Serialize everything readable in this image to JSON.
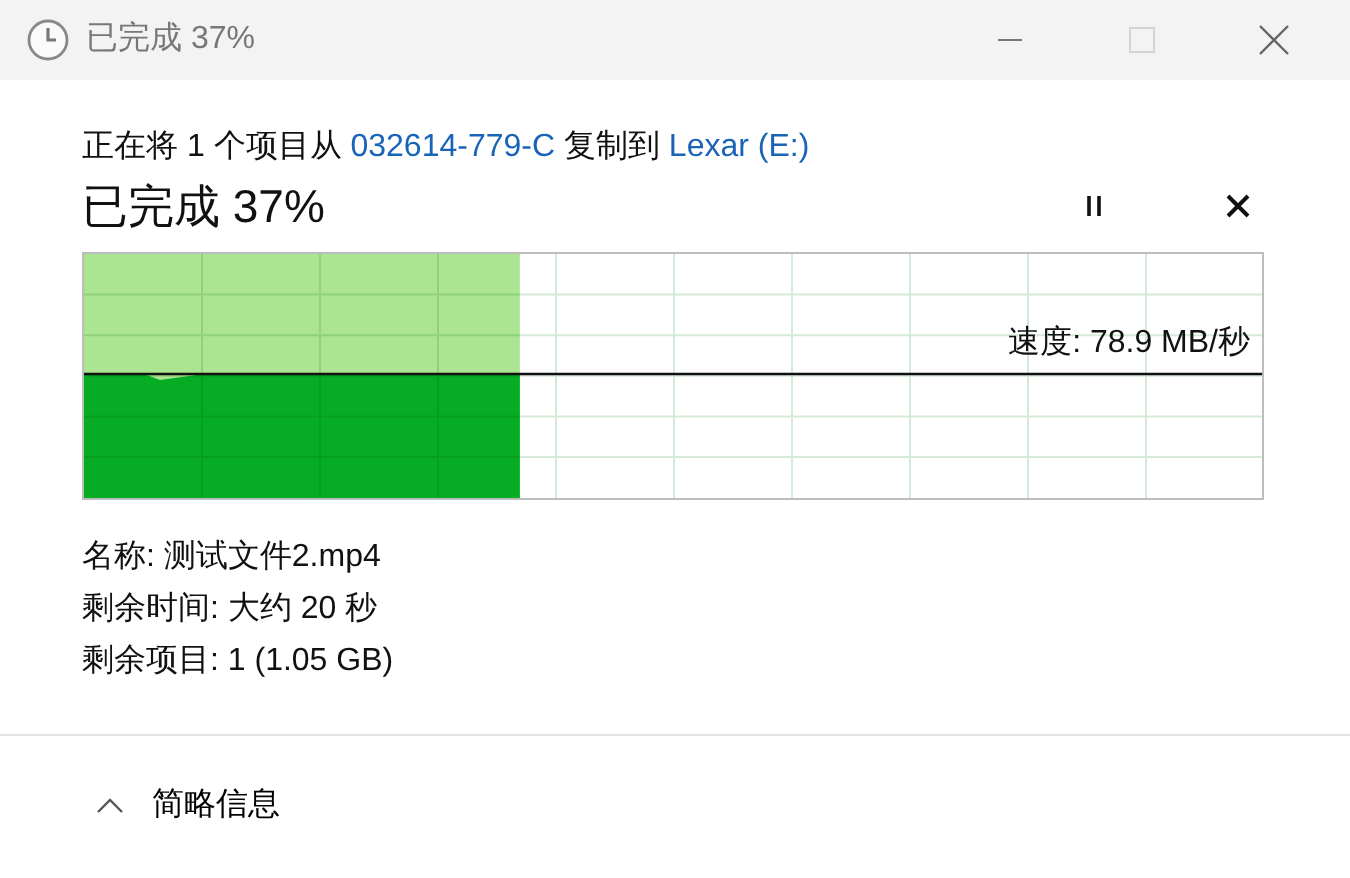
{
  "window": {
    "title": "已完成 37%",
    "maximize_disabled": true
  },
  "header": {
    "before": "正在将 1 个项目从",
    "source": "032614-779-C",
    "middle": "复制到",
    "destination": "Lexar (E:)"
  },
  "progress": {
    "label": "已完成 37%",
    "level": 0.37
  },
  "graph": {
    "speed": "速度: 78.9 MB/秒"
  },
  "details": [
    "名称: 测试文件2.mp4",
    "剩余时间: 大约 20 秒",
    "剩余项目: 1 (1.05 GB)"
  ],
  "footer": {
    "label": "简略信息",
    "expanded": true
  }
}
